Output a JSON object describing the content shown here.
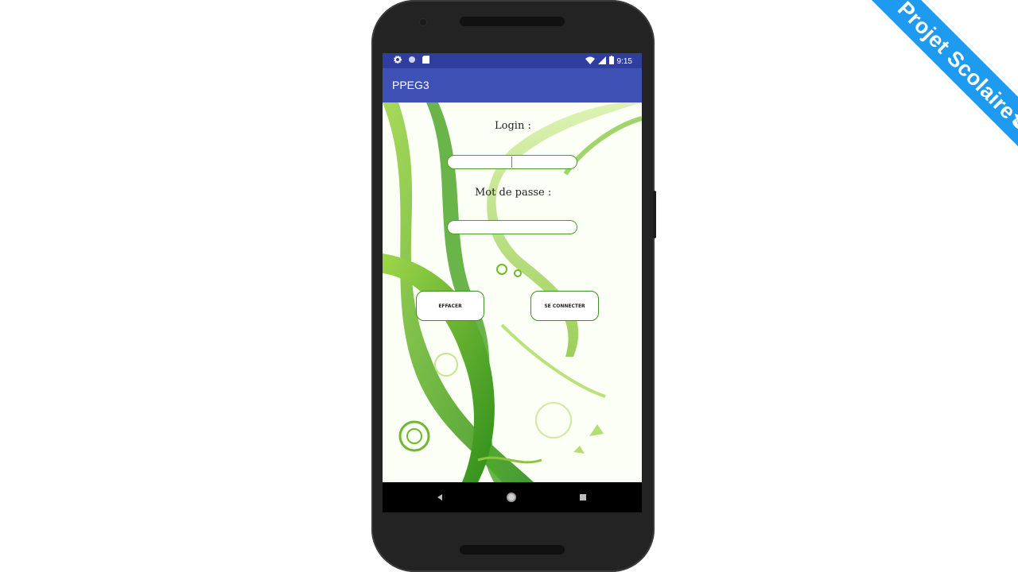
{
  "ribbon": {
    "text": "Projet Scolaire",
    "color": "#1e9bf0"
  },
  "status_bar": {
    "time": "9:15",
    "icons_left": [
      "settings-icon",
      "circle-icon",
      "sd-card-icon"
    ],
    "icons_right": [
      "wifi-icon",
      "signal-icon",
      "battery-icon"
    ]
  },
  "app_bar": {
    "title": "PPEG3",
    "color": "#3f51b5"
  },
  "form": {
    "login_label": "Login :",
    "login_value": "",
    "password_label": "Mot de passe :",
    "password_value": "",
    "clear_button": "EFFACER",
    "connect_button": "SE CONNECTER"
  },
  "nav_bar": {
    "icons": [
      "back-icon",
      "home-icon",
      "recents-icon"
    ]
  }
}
